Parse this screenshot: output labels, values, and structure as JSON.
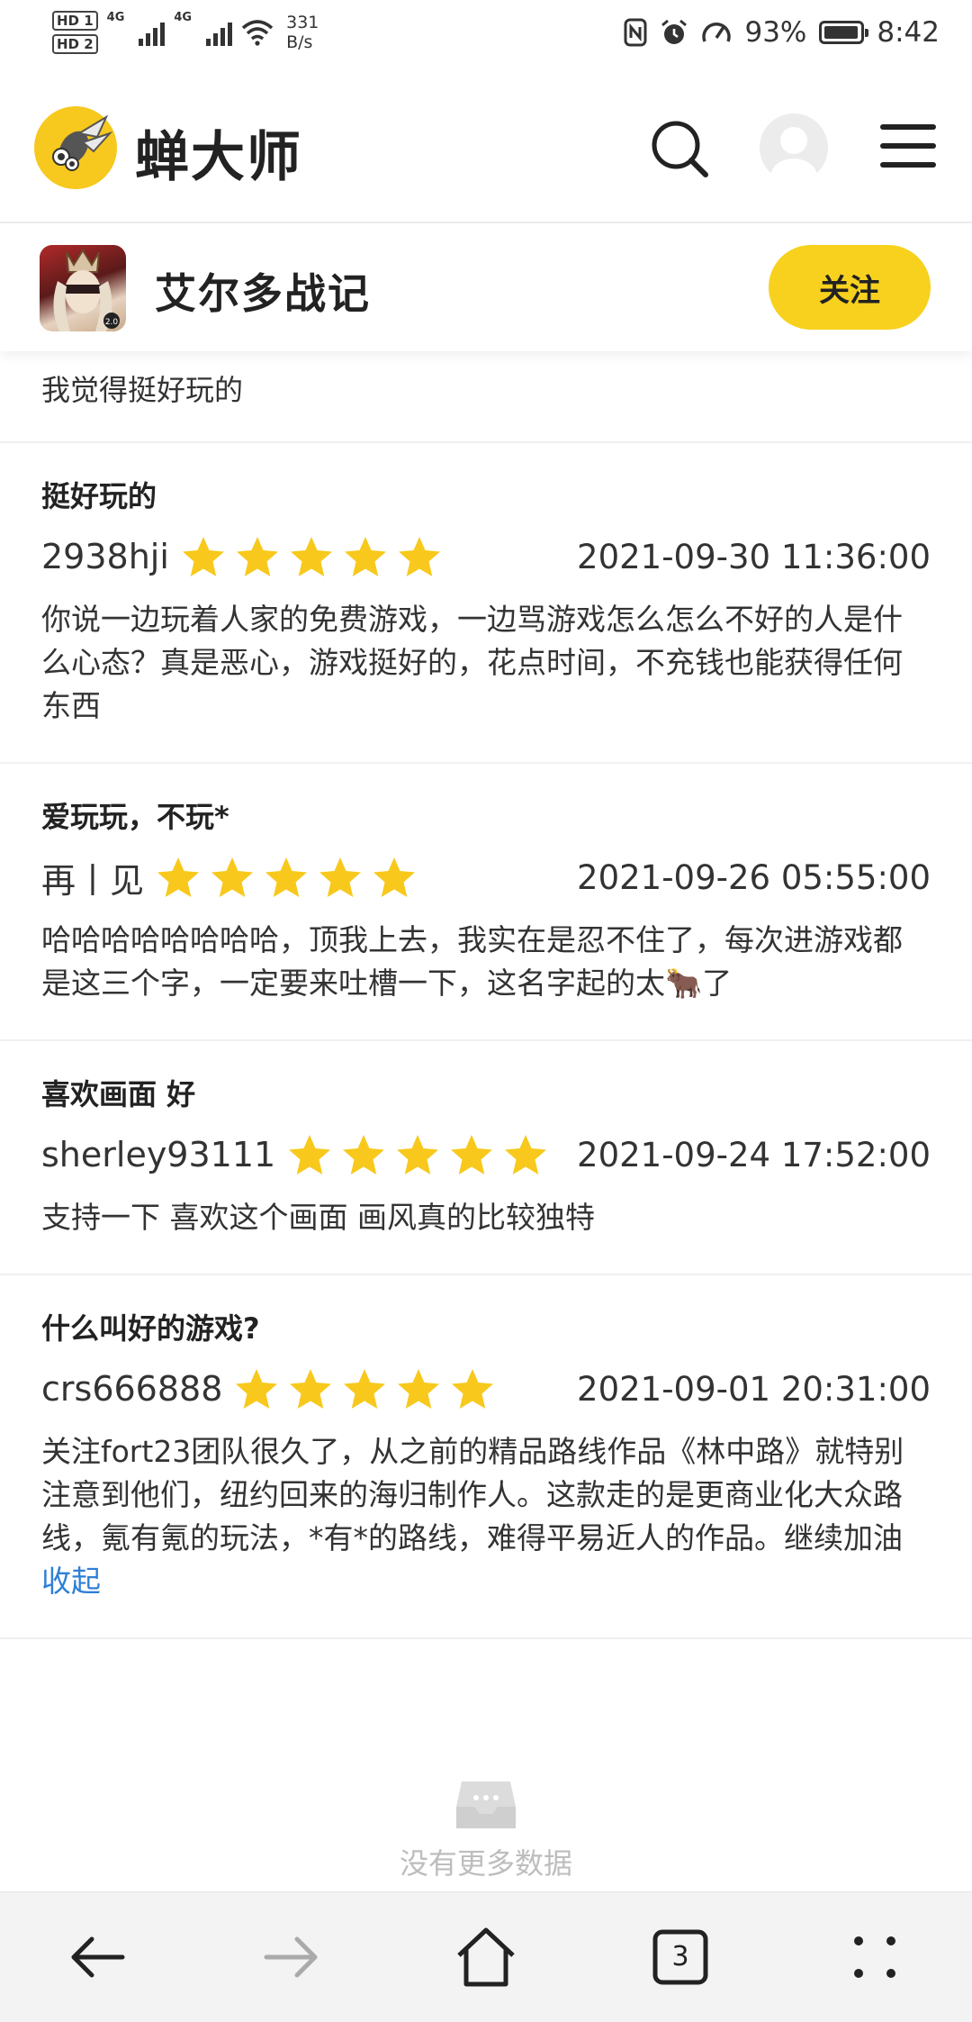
{
  "status_bar": {
    "hd1": "HD 1",
    "hd2": "HD 2",
    "net_tag1": "4G",
    "net_tag2": "4G",
    "speed_value": "331",
    "speed_unit": "B/s",
    "battery": "93%",
    "time": "8:42"
  },
  "app": {
    "brand": "蝉大师",
    "brand_color": "#f7c81d"
  },
  "game": {
    "name": "艾尔多战记",
    "follow_label": "关注"
  },
  "previous_review_tail": "我觉得挺好玩的",
  "reviews": [
    {
      "title": "挺好玩的",
      "user": "2938hji",
      "rating": 5,
      "date": "2021-09-30 11:36:00",
      "body": "你说一边玩着人家的免费游戏，一边骂游戏怎么怎么不好的人是什么心态？真是恶心，游戏挺好的，花点时间，不充钱也能获得任何东西"
    },
    {
      "title": "爱玩玩，不玩*",
      "user": "再丨见",
      "rating": 5,
      "date": "2021-09-26 05:55:00",
      "body": "哈哈哈哈哈哈哈哈，顶我上去，我实在是忍不住了，每次进游戏都是这三个字，一定要来吐槽一下，这名字起的太🐂了"
    },
    {
      "title": "喜欢画面 好",
      "user": "sherley93111",
      "rating": 5,
      "date": "2021-09-24 17:52:00",
      "body": "支持一下 喜欢这个画面 画风真的比较独特"
    },
    {
      "title": "什么叫好的游戏?",
      "user": "crs666888",
      "rating": 5,
      "date": "2021-09-01 20:31:00",
      "body": "关注fort23团队很久了，从之前的精品路线作品《林中路》就特别注意到他们，纽约回来的海归制作人。这款走的是更商业化大众路线，氪有氪的玩法，*有*的路线，难得平易近人的作品。继续加油",
      "collapse_label": "收起"
    }
  ],
  "empty_state": {
    "icon": "inbox-icon",
    "text": "没有更多数据"
  },
  "nav": {
    "tab_count": "3",
    "icons": [
      "back-arrow-icon",
      "forward-arrow-icon",
      "home-icon",
      "tabs-icon",
      "more-icon"
    ]
  },
  "colors": {
    "star": "#f8c91c",
    "link": "#2f7fd6",
    "follow_button": "#f7d11e"
  }
}
